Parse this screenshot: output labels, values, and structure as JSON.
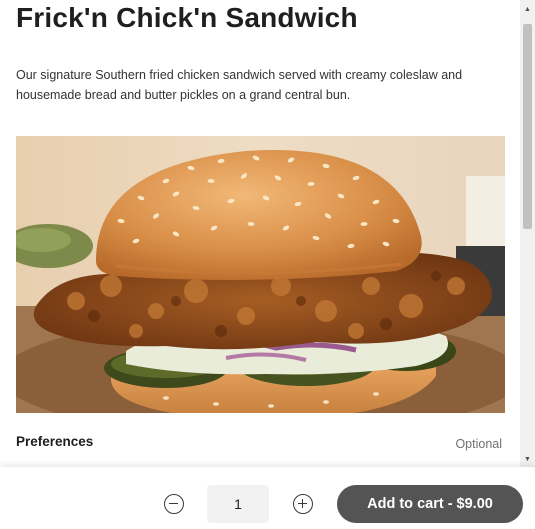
{
  "item": {
    "title": "Frick'n Chick'n Sandwich",
    "description": "Our signature Southern fried chicken sandwich served with creamy coleslaw and housemade bread and butter pickles on a grand central bun."
  },
  "preferences": {
    "label": "Preferences",
    "status": "Optional"
  },
  "cart": {
    "quantity": "1",
    "add_button_label": "Add to cart - $9.00"
  },
  "colors": {
    "button_bg": "#545454",
    "qty_bg": "#f2f2f2"
  },
  "icons": {
    "decrease": "minus-circle-icon",
    "increase": "plus-circle-icon"
  }
}
